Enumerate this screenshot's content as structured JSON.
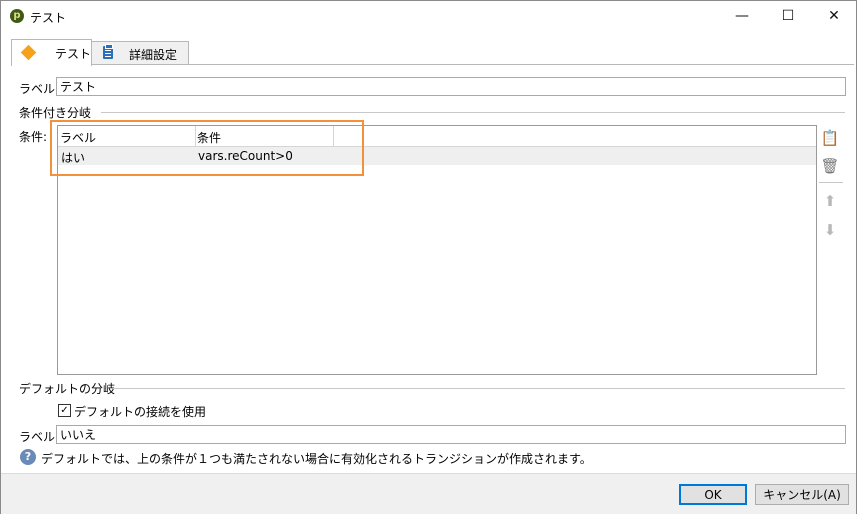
{
  "window": {
    "title": "テスト",
    "app_icon_glyph": "p",
    "minimize_glyph": "—",
    "maximize_glyph": "☐",
    "close_glyph": "✕"
  },
  "tabs": [
    {
      "label": "テスト",
      "icon": "diamond-icon",
      "active": true
    },
    {
      "label": "詳細設定",
      "icon": "clipboard-icon",
      "active": false
    }
  ],
  "form": {
    "label_caption": "ラベル:",
    "label_value": "テスト",
    "conditional_section": "条件付き分岐",
    "conditions_caption": "条件:",
    "grid": {
      "columns": [
        "ラベル",
        "条件"
      ],
      "rows": [
        {
          "label": "はい",
          "condition": "vars.reCount>0"
        }
      ]
    },
    "default_section": "デフォルトの分岐",
    "use_default_checkbox": "デフォルトの接続を使用",
    "use_default_checked": true,
    "check_glyph": "✓",
    "default_label_caption": "ラベル:",
    "default_label_value": "いいえ",
    "info_glyph": "?",
    "info_text": "デフォルトでは、上の条件が１つも満たされない場合に有効化されるトランジションが作成されます。"
  },
  "side_tools": {
    "add_glyph": "📋",
    "delete_glyph": "🗑",
    "up_glyph": "⬆",
    "down_glyph": "⬇"
  },
  "buttons": {
    "ok": "OK",
    "cancel": "キャンセル(A)"
  },
  "colors": {
    "highlight": "#f2913a",
    "accent": "#0078d7",
    "diamond": "#f5a21a"
  }
}
